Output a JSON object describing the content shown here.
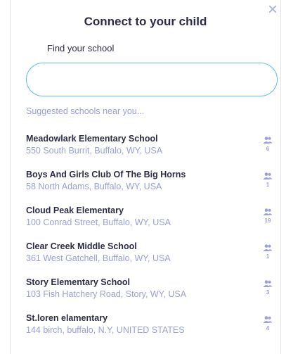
{
  "dialog": {
    "title": "Connect to your child",
    "close_icon": "×",
    "find_label": "Find your school",
    "search_value": "",
    "suggest_label": "Suggested schools near you...",
    "accent_color": "#5bbfe8",
    "muted_color": "#9aa0d6"
  },
  "schools": [
    {
      "name": "Meadowlark Elementary School",
      "address": "550 South Burrit, Buffalo, WY, USA",
      "count": "6"
    },
    {
      "name": "Boys And Girls Club Of The Big Horns",
      "address": "58 North Adams, Buffalo, WY, USA",
      "count": "1"
    },
    {
      "name": "Cloud Peak Elementary",
      "address": "100 Conrad Street, Buffalo, WY, USA",
      "count": "19"
    },
    {
      "name": "Clear Creek Middle School",
      "address": "361 West Gatchell, Buffalo, WY, USA",
      "count": "1"
    },
    {
      "name": "Story Elementary School",
      "address": "103 Fish Hatchery Road, Story, WY, USA",
      "count": "3"
    },
    {
      "name": "St.loren elamentary",
      "address": "144 birch, buffalo, N.Y, UNITED STATES",
      "count": "4"
    }
  ]
}
